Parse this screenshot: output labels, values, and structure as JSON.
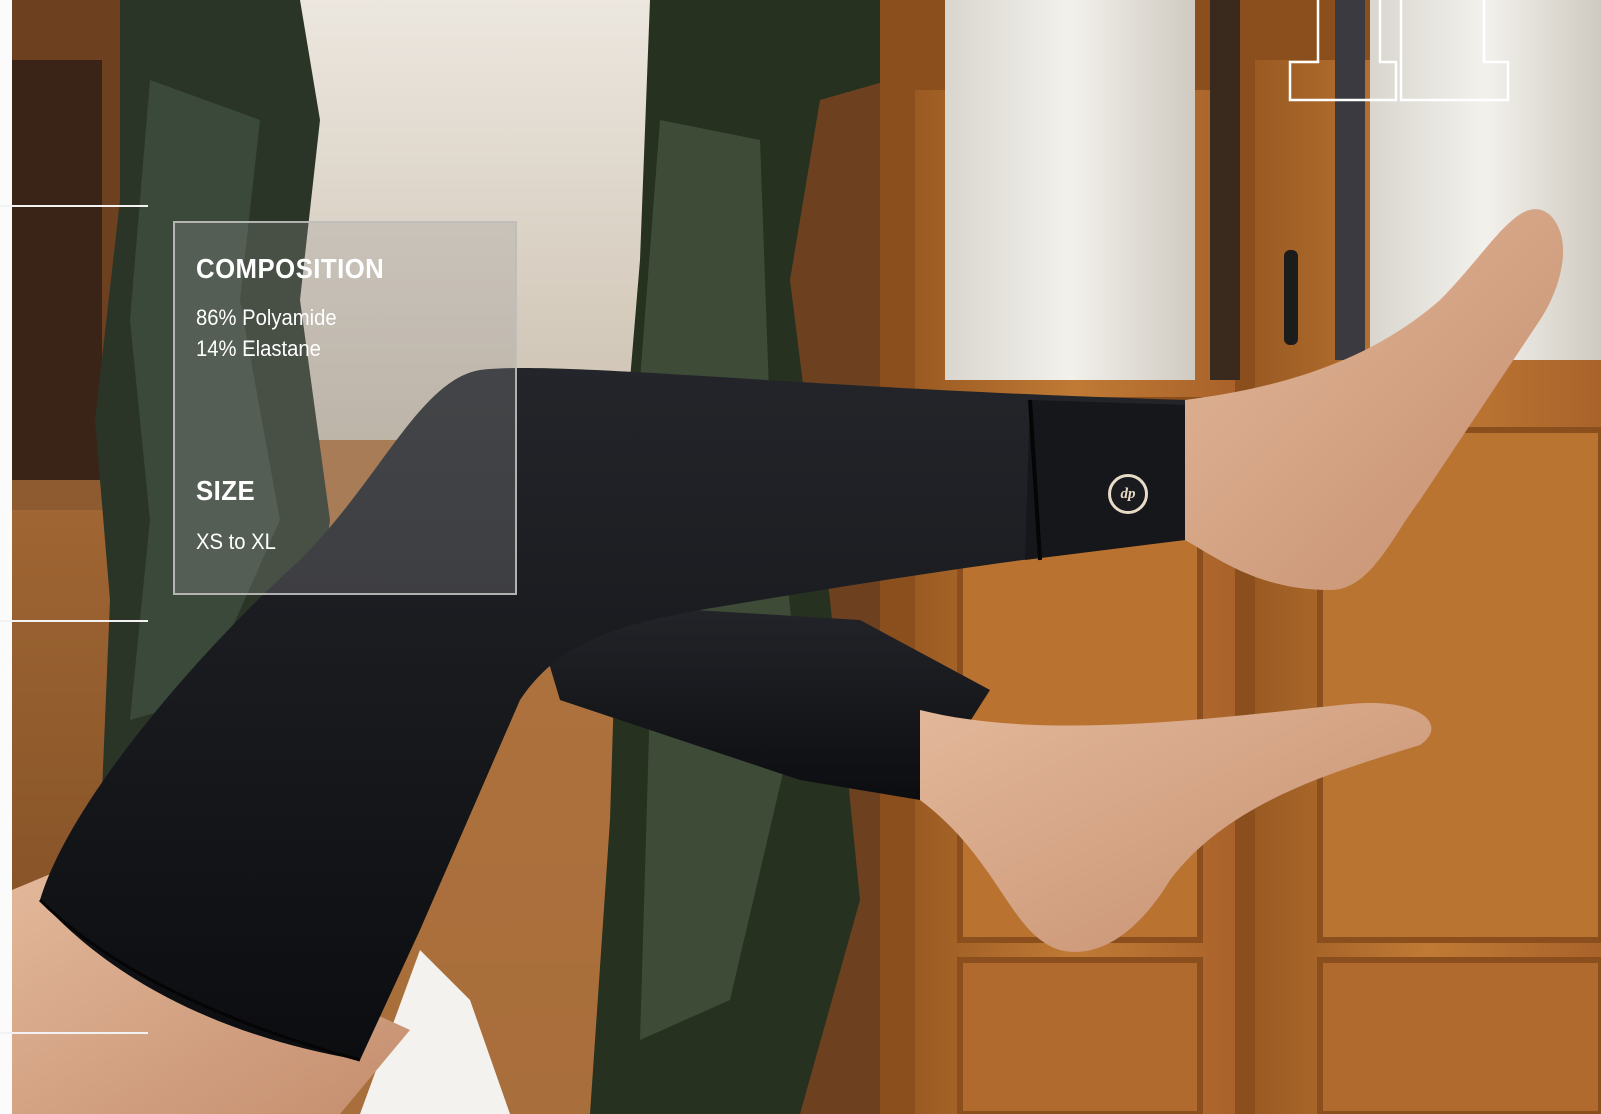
{
  "composition": {
    "heading": "COMPOSITION",
    "lines": [
      "86% Polyamide",
      "14% Elastane"
    ]
  },
  "size": {
    "heading": "SIZE",
    "value": "XS to XL"
  },
  "brand_badge": {
    "monogram": "dp"
  },
  "colors": {
    "legwear": "#121316",
    "wood": "#b06a2d",
    "curtain": "#2d3a2b",
    "panel_border": "#bebebe",
    "text": "#ffffff"
  }
}
